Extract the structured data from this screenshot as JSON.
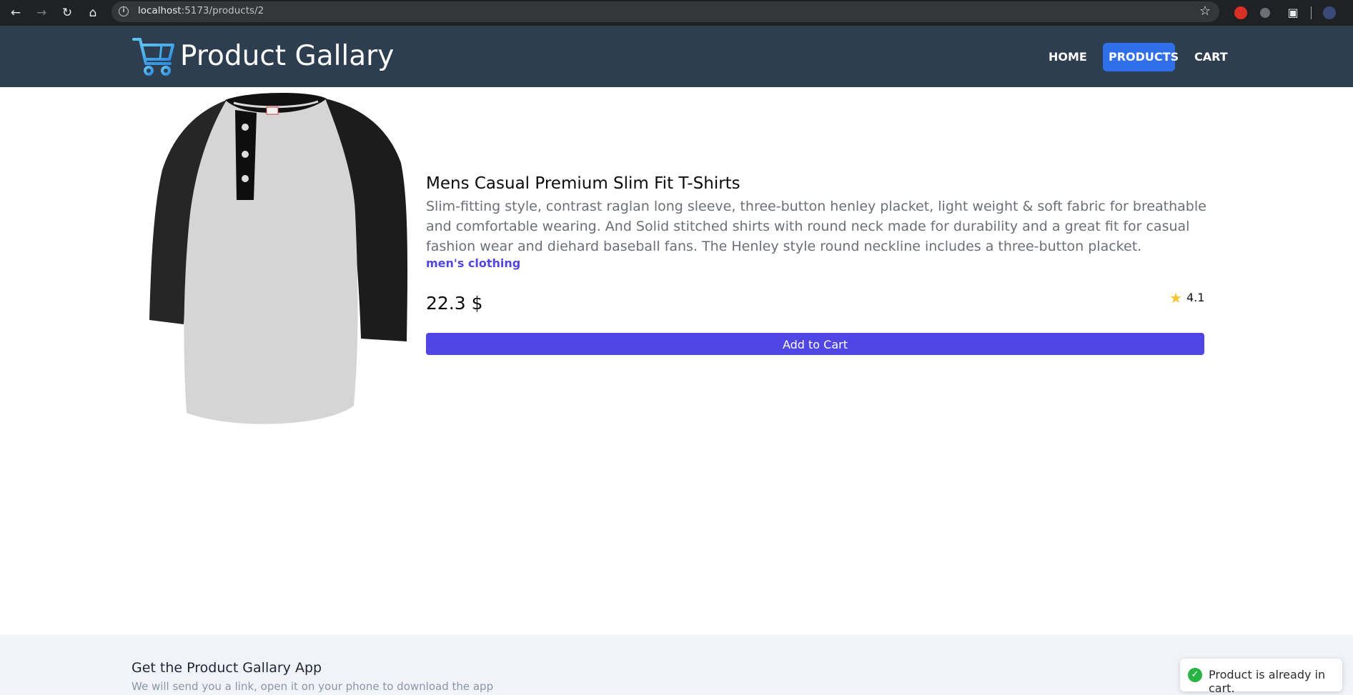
{
  "browser": {
    "url_host": "localhost",
    "url_path": ":5173/products/2"
  },
  "navbar": {
    "brand": "Product Gallary",
    "links": [
      {
        "label": "HOME"
      },
      {
        "label": "PRODUCTS",
        "active": true
      },
      {
        "label": "CART"
      }
    ],
    "colors": {
      "background": "#2d3e50",
      "active": "#2f6fe8"
    }
  },
  "product": {
    "title": "Mens Casual Premium Slim Fit T-Shirts",
    "description": "Slim-fitting style, contrast raglan long sleeve, three-button henley placket, light weight & soft fabric for breathable and comfortable wearing. And Solid stitched shirts with round neck made for durability and a great fit for casual fashion wear and diehard baseball fans. The Henley style round neckline includes a three-button placket.",
    "category": "men's clothing",
    "price": "22.3 $",
    "rating": "4.1",
    "add_to_cart_label": "Add to Cart",
    "accent_color": "#4f46e5"
  },
  "footer": {
    "title": "Get the Product Gallary App",
    "subtitle": "We will send you a link, open it on your phone to download the app"
  },
  "toast": {
    "message": "Product is already in cart.",
    "status_color": "#28b445"
  }
}
